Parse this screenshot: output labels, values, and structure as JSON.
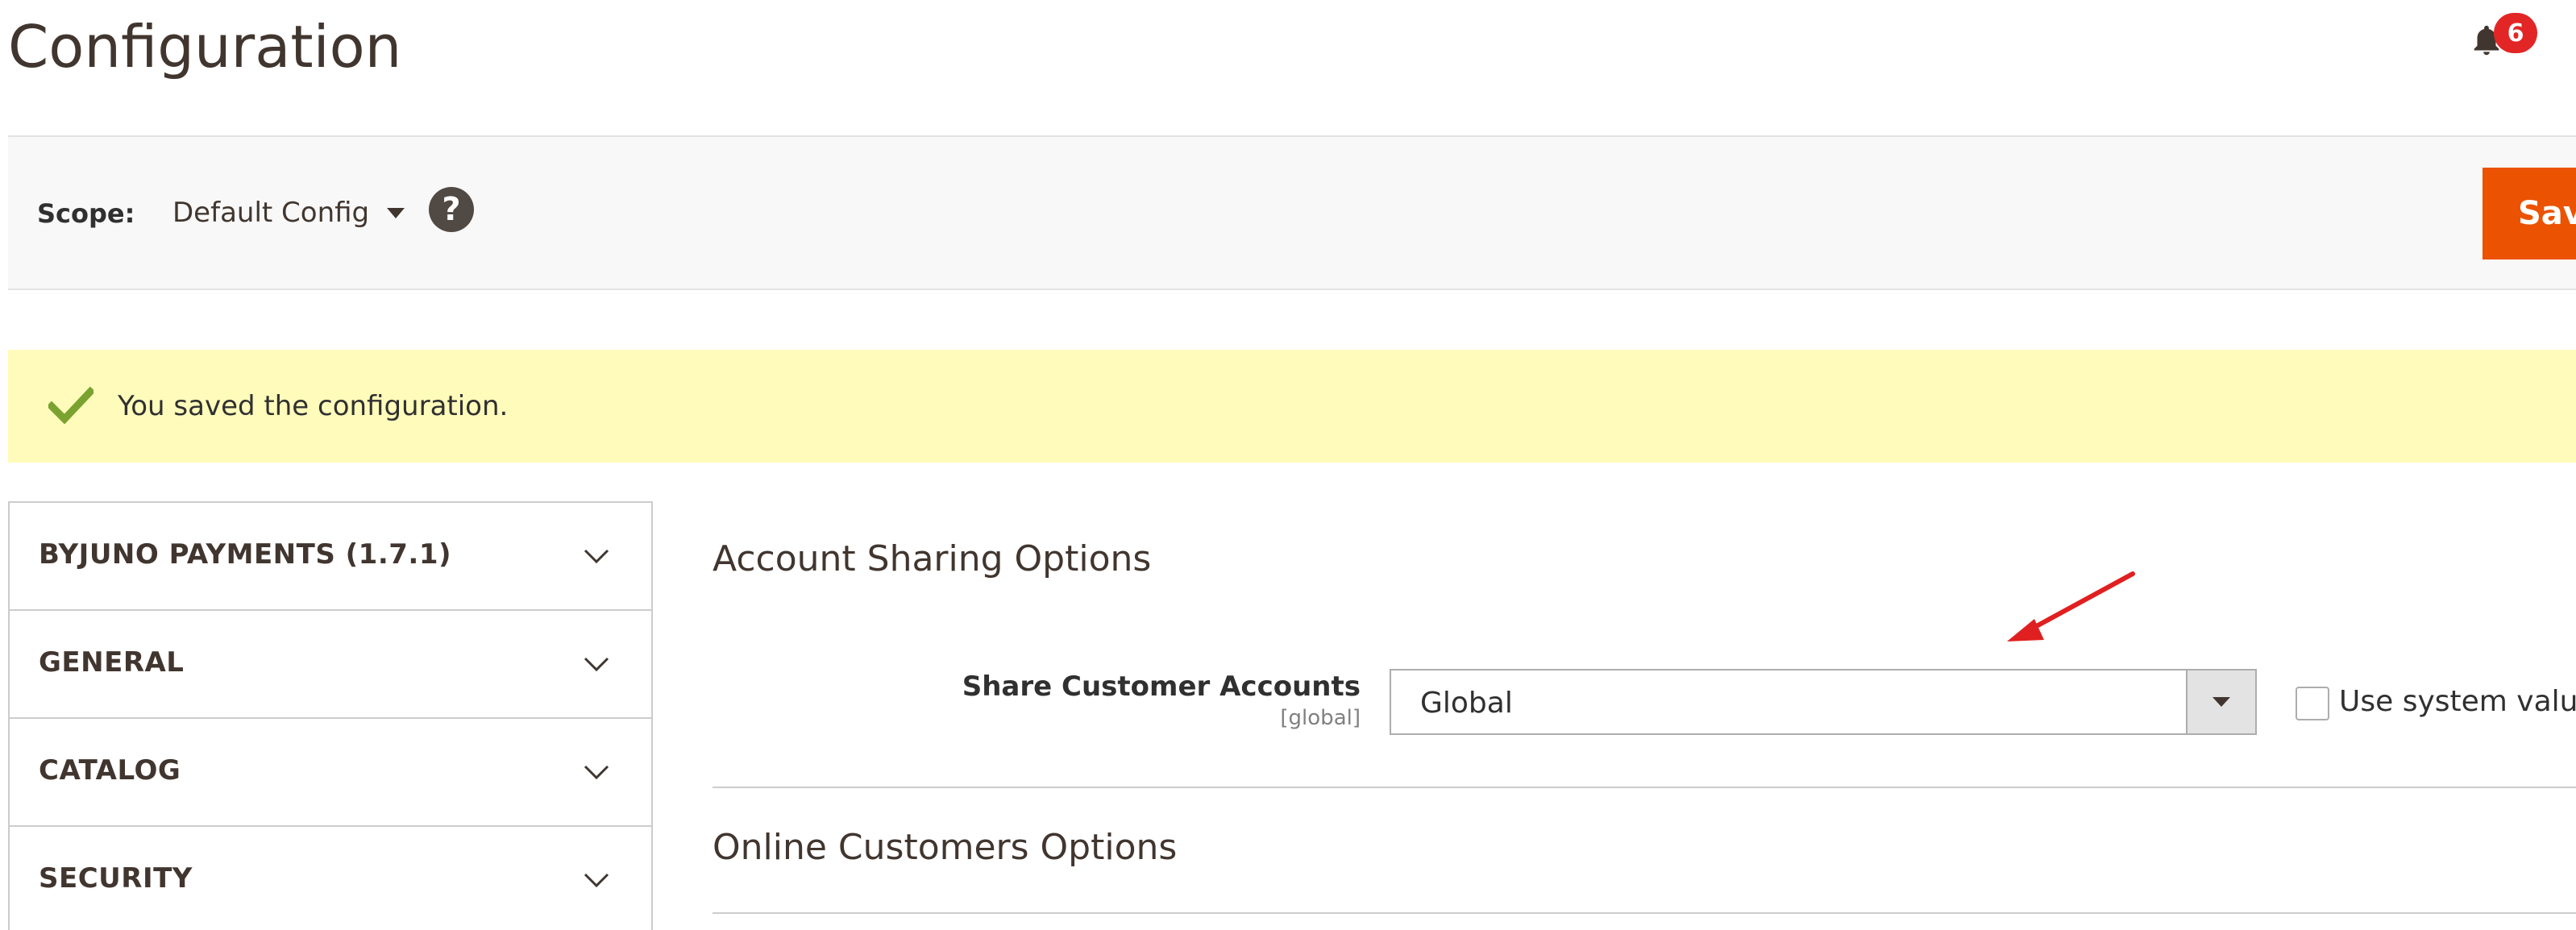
{
  "header": {
    "title": "Configuration",
    "notification_count": "6",
    "bell_icon": "bell-icon"
  },
  "scope_bar": {
    "label": "Scope:",
    "selected_scope": "Default Config",
    "help_icon_text": "?",
    "save_label": "Save Config"
  },
  "message": {
    "text": "You saved the configuration.",
    "icon": "check-icon",
    "color": "#79a22e"
  },
  "sidebar": {
    "items": [
      {
        "label": "BYJUNO PAYMENTS (1.7.1)"
      },
      {
        "label": "GENERAL"
      },
      {
        "label": "CATALOG"
      },
      {
        "label": "SECURITY"
      }
    ]
  },
  "main": {
    "sections": [
      {
        "title": "Account Sharing Options",
        "fields": [
          {
            "label": "Share Customer Accounts",
            "scope": "[global]",
            "value": "Global",
            "use_system_value_label": "Use system value",
            "use_system_value_checked": false
          }
        ]
      },
      {
        "title": "Online Customers Options"
      }
    ]
  },
  "colors": {
    "accent": "#eb5202",
    "message_bg": "#fffbbb",
    "badge": "#e22626",
    "annotation_arrow": "#e02020"
  }
}
